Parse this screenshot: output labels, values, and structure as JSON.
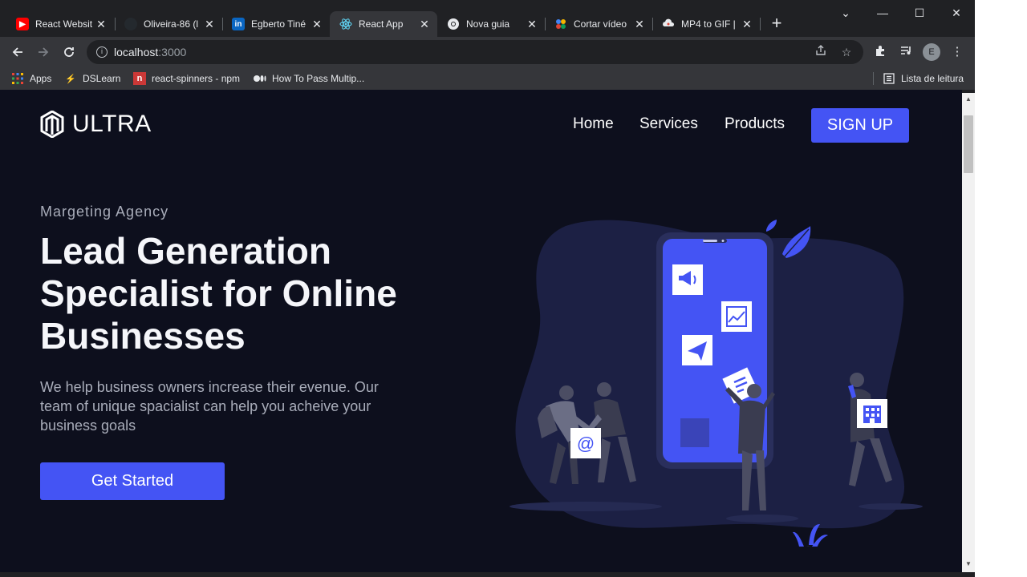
{
  "browser": {
    "tabs": [
      {
        "label": "React Websit",
        "favicon": "youtube-icon",
        "color": "#ff0000"
      },
      {
        "label": "Oliveira-86 (l",
        "favicon": "github-icon",
        "color": "#e8eaed"
      },
      {
        "label": "Egberto Tiné",
        "favicon": "linkedin-icon",
        "color": "#0a66c2"
      },
      {
        "label": "React App",
        "favicon": "react-icon",
        "color": "#61dafb",
        "active": true
      },
      {
        "label": "Nova guia",
        "favicon": "chrome-icon",
        "color": "#e8eaed"
      },
      {
        "label": "Cortar vídeo",
        "favicon": "cortar-icon",
        "color": "#f4b400"
      },
      {
        "label": "MP4 to GIF |",
        "favicon": "cloud-icon",
        "color": "#e8eaed"
      }
    ],
    "new_tab": "+",
    "window_controls": {
      "dropdown": "⌄",
      "minimize": "—",
      "maximize": "☐",
      "close": "✕"
    },
    "address": {
      "host": "localhost",
      "port": ":3000"
    },
    "profile_initial": "E",
    "bookmarks": [
      {
        "label": "Apps",
        "icon": "apps-grid-icon"
      },
      {
        "label": "DSLearn",
        "icon": "lightning-icon"
      },
      {
        "label": "react-spinners - npm",
        "icon": "npm-icon"
      },
      {
        "label": "How To Pass Multip...",
        "icon": "medium-icon"
      }
    ],
    "reading_list": "Lista de leitura"
  },
  "site": {
    "brand": "ULTRA",
    "nav": {
      "home": "Home",
      "services": "Services",
      "products": "Products",
      "signup": "SIGN UP"
    },
    "hero": {
      "eyebrow": "Margeting Agency",
      "headline": "Lead Generation Specialist for Online Businesses",
      "subtext": "We help business owners increase their evenue. Our team of unique spacialist can help you acheive your business goals",
      "cta": "Get Started"
    },
    "illustration": {
      "email_symbol": "@"
    }
  },
  "colors": {
    "page_bg": "#0d0f1d",
    "accent": "#4454f4",
    "blob": "#1c2044"
  }
}
